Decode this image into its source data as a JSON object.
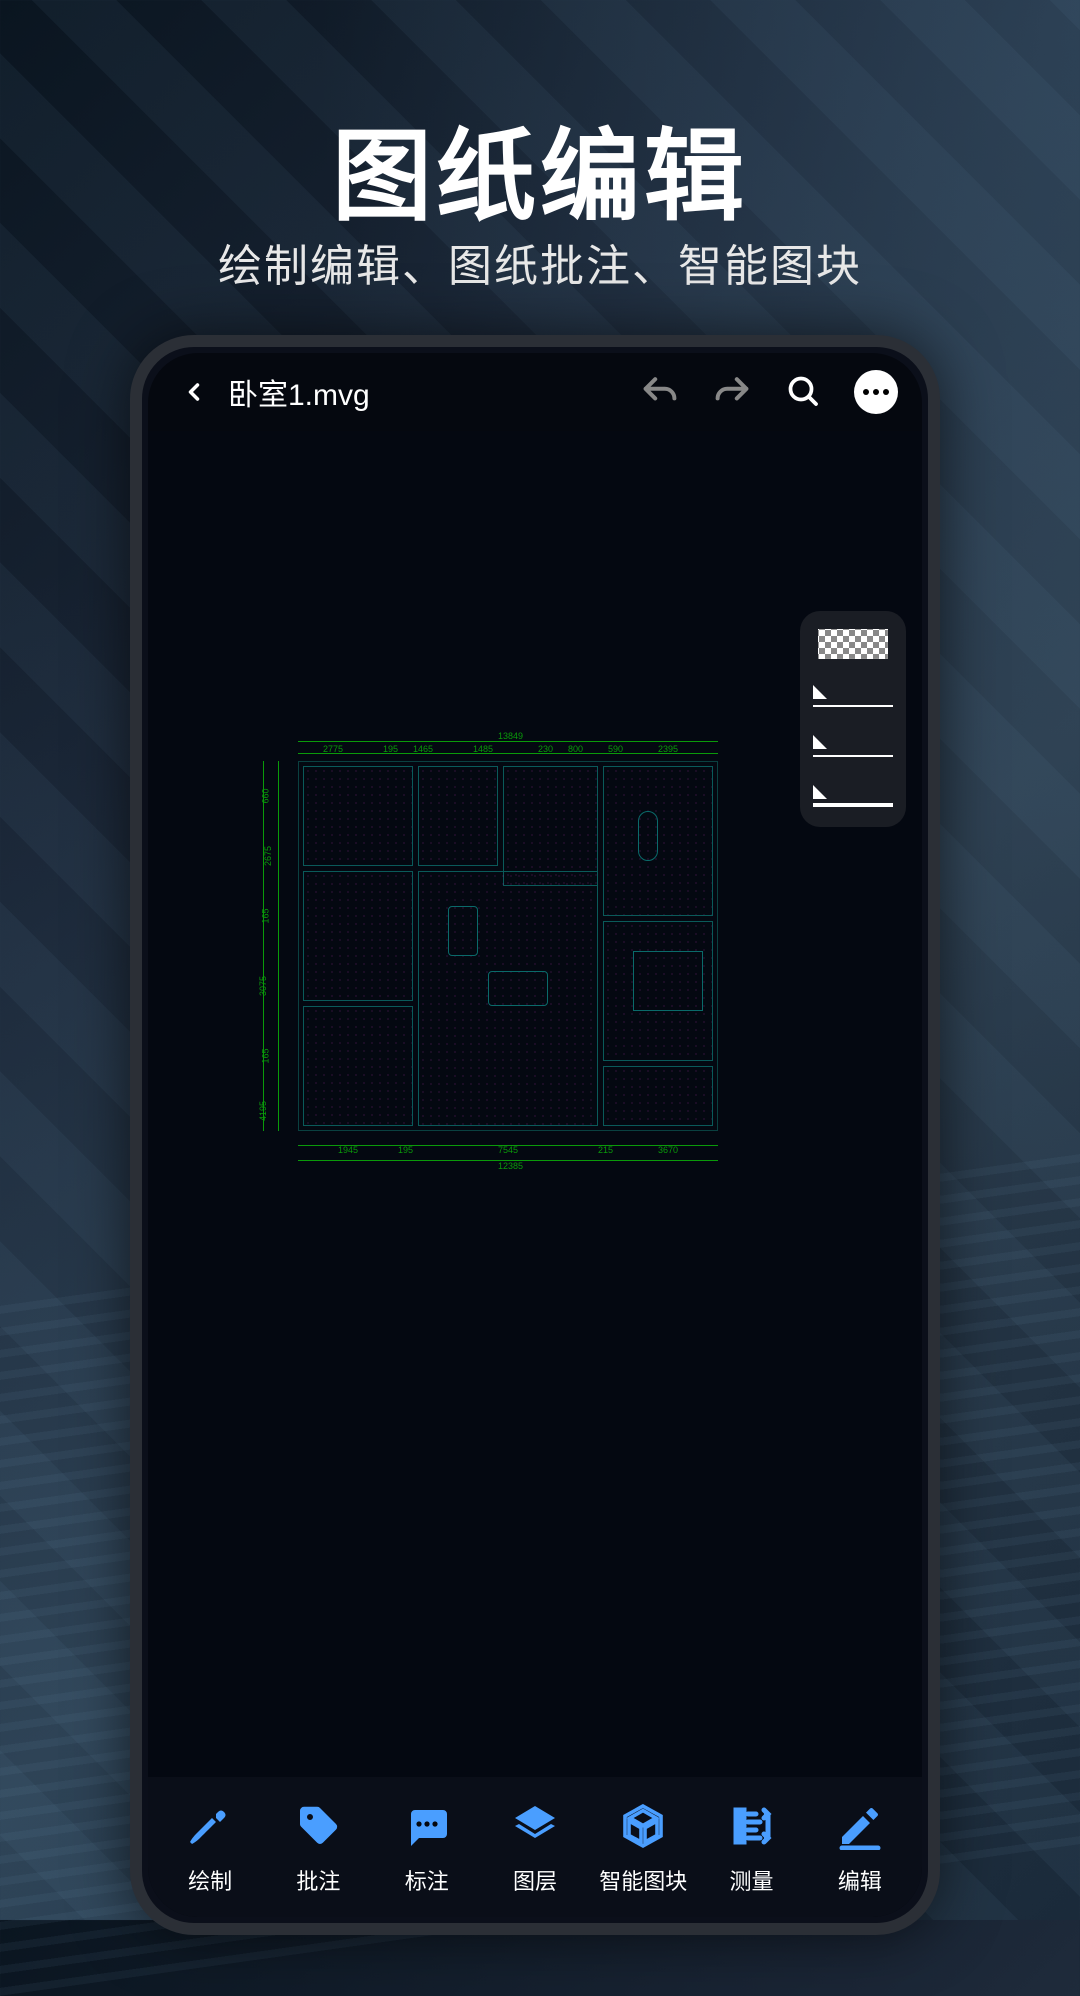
{
  "hero": {
    "title": "图纸编辑",
    "subtitle": "绘制编辑、图纸批注、智能图块"
  },
  "app": {
    "filename": "卧室1.mvg"
  },
  "palette": {
    "items": [
      "transparent",
      "line-thin",
      "line-thin",
      "line-bold"
    ]
  },
  "toolbar": [
    {
      "id": "draw",
      "label": "绘制",
      "icon": "pen-icon"
    },
    {
      "id": "annotate",
      "label": "批注",
      "icon": "tag-icon"
    },
    {
      "id": "markup",
      "label": "标注",
      "icon": "comment-icon"
    },
    {
      "id": "layers",
      "label": "图层",
      "icon": "layers-icon"
    },
    {
      "id": "smartblock",
      "label": "智能图块",
      "icon": "cube-icon"
    },
    {
      "id": "measure",
      "label": "测量",
      "icon": "measure-icon"
    },
    {
      "id": "edit",
      "label": "编辑",
      "icon": "pencil-icon"
    }
  ],
  "colors": {
    "accent": "#4a9eff",
    "cad_green": "#0a9a0a",
    "cad_cyan": "#0a6a6a",
    "cad_magenta": "#c832c8"
  }
}
